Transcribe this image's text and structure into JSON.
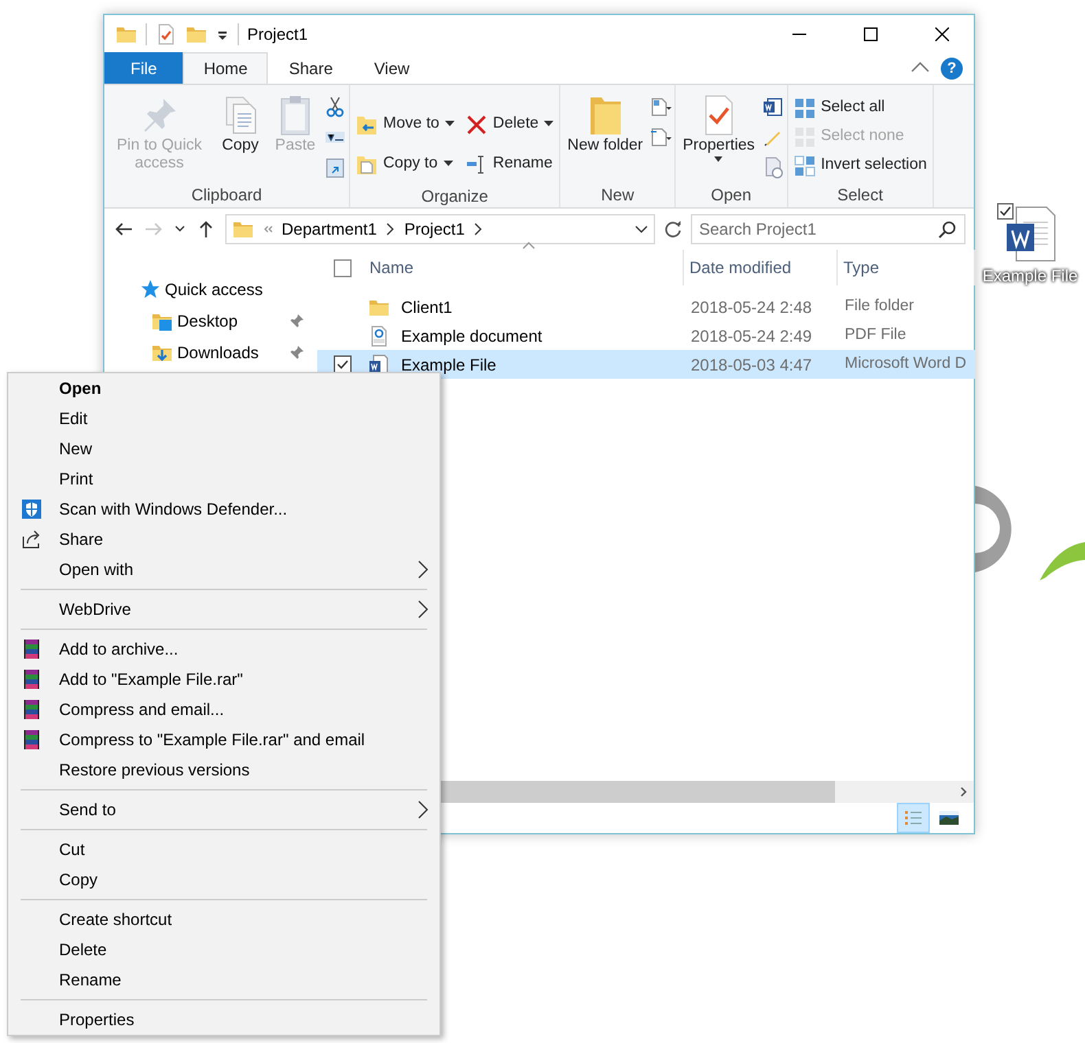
{
  "window": {
    "title": "Project1"
  },
  "ribbon": {
    "tabs": [
      {
        "label": "File",
        "kind": "file",
        "selected": false
      },
      {
        "label": "Home",
        "kind": "tab",
        "selected": true
      },
      {
        "label": "Share",
        "kind": "tab",
        "selected": false
      },
      {
        "label": "View",
        "kind": "tab",
        "selected": false
      }
    ],
    "help": "?",
    "groups": [
      {
        "label": "Clipboard",
        "commands": [
          {
            "label": "Pin to Quick access",
            "kind": "large",
            "disabled": true
          },
          {
            "label": "Copy",
            "kind": "large",
            "disabled": false
          },
          {
            "label": "Paste",
            "kind": "large",
            "disabled": true
          }
        ]
      },
      {
        "label": "Organize",
        "commands": [
          {
            "label": "Move to",
            "kind": "small",
            "has_menu": true,
            "disabled": false
          },
          {
            "label": "Copy to",
            "kind": "small",
            "has_menu": true,
            "disabled": false
          },
          {
            "label": "Delete",
            "kind": "small",
            "has_menu": true,
            "disabled": false
          },
          {
            "label": "Rename",
            "kind": "small",
            "has_menu": false,
            "disabled": false
          }
        ]
      },
      {
        "label": "New",
        "commands": [
          {
            "label": "New folder",
            "kind": "large",
            "disabled": false
          }
        ]
      },
      {
        "label": "Open",
        "commands": [
          {
            "label": "Properties",
            "kind": "large",
            "has_menu": true,
            "disabled": false
          }
        ]
      },
      {
        "label": "Select",
        "commands": [
          {
            "label": "Select all",
            "kind": "small",
            "disabled": false
          },
          {
            "label": "Select none",
            "kind": "small",
            "disabled": true
          },
          {
            "label": "Invert selection",
            "kind": "small",
            "disabled": false
          }
        ]
      }
    ]
  },
  "address_bar": {
    "path": [
      "Department1",
      "Project1"
    ],
    "search": {
      "placeholder": "Search Project1"
    }
  },
  "navigation": {
    "items": [
      {
        "label": "Quick access",
        "children": [
          {
            "label": "Desktop",
            "pinned": true
          },
          {
            "label": "Downloads",
            "pinned": true
          }
        ]
      }
    ]
  },
  "file_list": {
    "header_checked": false,
    "columns": [
      "Name",
      "Date modified",
      "Type"
    ],
    "rows": [
      {
        "kind": "folder",
        "name": "Client1",
        "date": "2018-05-24 2:48",
        "type": "File folder",
        "selected": false,
        "checked": false
      },
      {
        "kind": "pdf",
        "name": "Example document",
        "date": "2018-05-24 2:49",
        "type": "PDF File",
        "selected": false,
        "checked": false
      },
      {
        "kind": "word",
        "name": "Example File",
        "date": "2018-05-03 4:47",
        "type": "Microsoft Word D",
        "selected": true,
        "checked": true
      }
    ]
  },
  "status_bar": {
    "views": [
      {
        "kind": "details",
        "selected": true
      },
      {
        "kind": "large-icons",
        "selected": false
      }
    ]
  },
  "context_menu": {
    "sections": [
      {
        "items": [
          {
            "label": "Open",
            "kind": "plain",
            "default": true,
            "submenu": false
          },
          {
            "label": "Edit",
            "kind": "plain",
            "default": false,
            "submenu": false
          },
          {
            "label": "New",
            "kind": "plain",
            "default": false,
            "submenu": false
          },
          {
            "label": "Print",
            "kind": "plain",
            "default": false,
            "submenu": false
          },
          {
            "label": "Scan with Windows Defender...",
            "kind": "shield",
            "default": false,
            "submenu": false
          },
          {
            "label": "Share",
            "kind": "share",
            "default": false,
            "submenu": false
          },
          {
            "label": "Open with",
            "kind": "plain",
            "default": false,
            "submenu": true
          }
        ]
      },
      {
        "items": [
          {
            "label": "WebDrive",
            "kind": "plain",
            "default": false,
            "submenu": true
          }
        ]
      },
      {
        "items": [
          {
            "label": "Add to archive...",
            "kind": "archive",
            "default": false,
            "submenu": false
          },
          {
            "label": "Add to \"Example File.rar\"",
            "kind": "archive",
            "default": false,
            "submenu": false
          },
          {
            "label": "Compress and email...",
            "kind": "archive",
            "default": false,
            "submenu": false
          },
          {
            "label": "Compress to \"Example File.rar\" and email",
            "kind": "archive",
            "default": false,
            "submenu": false
          },
          {
            "label": "Restore previous versions",
            "kind": "plain",
            "default": false,
            "submenu": false
          }
        ]
      },
      {
        "items": [
          {
            "label": "Send to",
            "kind": "plain",
            "default": false,
            "submenu": true
          }
        ]
      },
      {
        "items": [
          {
            "label": "Cut",
            "kind": "plain",
            "default": false,
            "submenu": false
          },
          {
            "label": "Copy",
            "kind": "plain",
            "default": false,
            "submenu": false
          }
        ]
      },
      {
        "items": [
          {
            "label": "Create shortcut",
            "kind": "plain",
            "default": false,
            "submenu": false
          },
          {
            "label": "Delete",
            "kind": "plain",
            "default": false,
            "submenu": false
          },
          {
            "label": "Rename",
            "kind": "plain",
            "default": false,
            "submenu": false
          }
        ]
      },
      {
        "items": [
          {
            "label": "Properties",
            "kind": "plain",
            "default": false,
            "submenu": false
          }
        ]
      }
    ]
  },
  "desktop_icon": {
    "label": "Example File",
    "checked": true
  }
}
